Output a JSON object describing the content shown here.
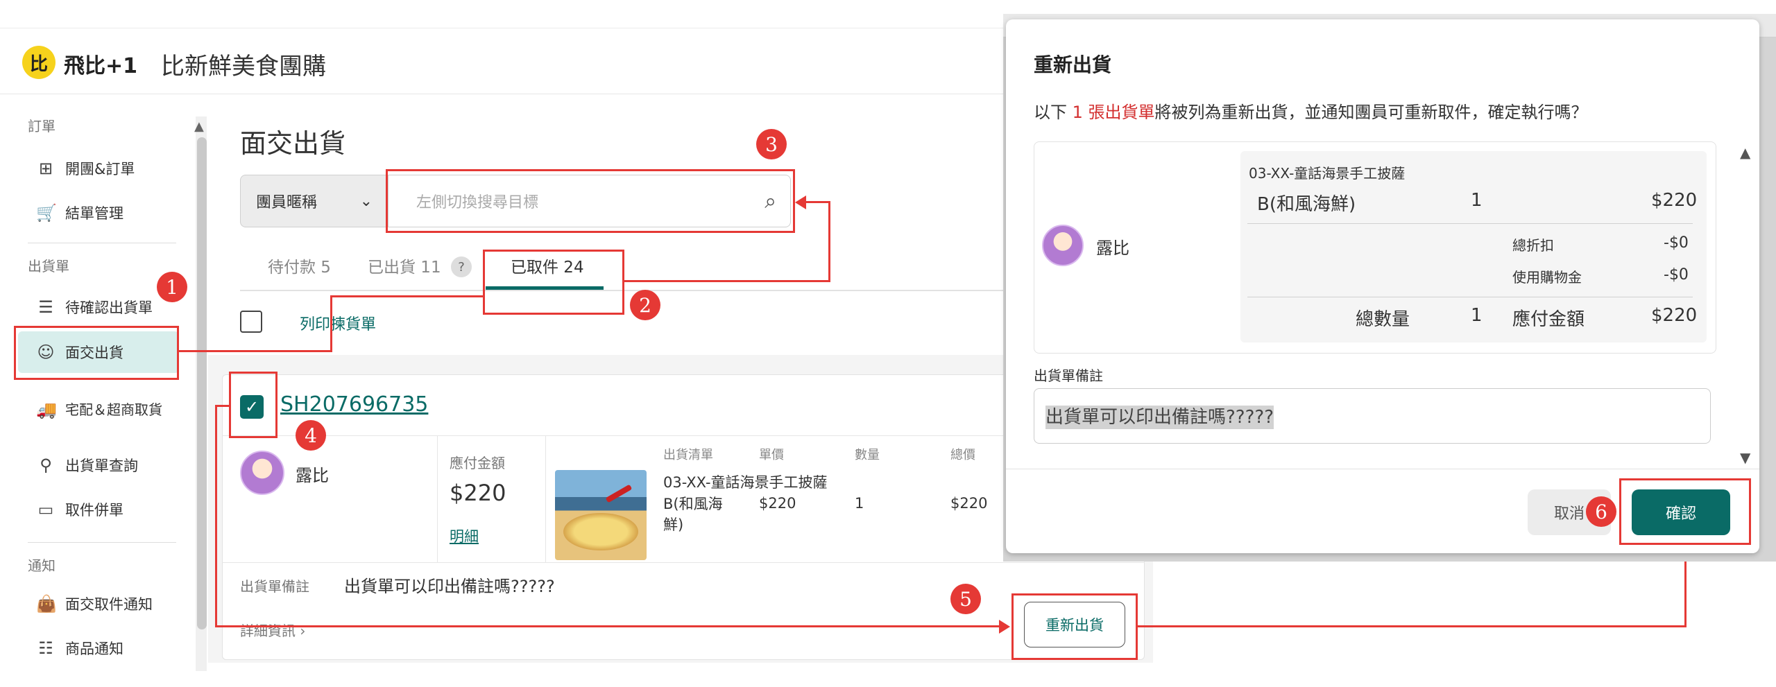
{
  "header": {
    "logo_mark": "比",
    "brand_name": "飛比+1",
    "shop_name": "比新鮮美食團購"
  },
  "sidebar": {
    "sections": [
      {
        "title": "訂單",
        "items": [
          {
            "icon": "grid-icon",
            "label": "開團&訂單"
          },
          {
            "icon": "cart-icon",
            "label": "結單管理"
          }
        ]
      },
      {
        "title": "出貨單",
        "items": [
          {
            "icon": "list-icon",
            "label": "待確認出貨單"
          },
          {
            "icon": "smile-icon",
            "label": "面交出貨"
          },
          {
            "icon": "truck-icon",
            "label": "宅配＆超商取貨"
          },
          {
            "icon": "search-icon",
            "label": "出貨單查詢"
          },
          {
            "icon": "box-icon",
            "label": "取件併單"
          }
        ]
      },
      {
        "title": "通知",
        "items": [
          {
            "icon": "bag-icon",
            "label": "面交取件通知"
          },
          {
            "icon": "sliders-icon",
            "label": "商品通知"
          }
        ]
      }
    ]
  },
  "main": {
    "title": "面交出貨",
    "filter_select": "團員暱稱",
    "search_placeholder": "左側切換搜尋目標",
    "tabs": [
      {
        "label": "待付款 5"
      },
      {
        "label": "已出貨 11"
      },
      {
        "label": "已取件 24"
      }
    ],
    "help_mark": "?",
    "print_label": "列印揀貨單",
    "order": {
      "id": "SH207696735",
      "user": "露比",
      "pay_label": "應付金額",
      "pay_amount": "$220",
      "detail_link": "明細",
      "table_headers": [
        "出貨清單",
        "單價",
        "數量",
        "總價"
      ],
      "item": {
        "name": "03-XX-童話海景手工披薩",
        "variant": "B(和風海鮮)",
        "price": "$220",
        "qty": "1",
        "total": "$220"
      },
      "remark_label": "出貨單備註",
      "remark": "出貨單可以印出備註嗎?????",
      "more_info": "詳細資訊 ›",
      "reship_button": "重新出貨"
    }
  },
  "annotations": {
    "markers": [
      "1",
      "2",
      "3",
      "4",
      "5",
      "6"
    ],
    "color": "#e53935"
  },
  "modal": {
    "title": "重新出貨",
    "desc_prefix": "以下 ",
    "desc_highlight": "1 張出貨單",
    "desc_suffix": "將被列為重新出貨，並通知團員可重新取件，確定執行嗎？",
    "user": "露比",
    "item_name": "03-XX-童話海景手工披薩",
    "item_variant": "B(和風海鮮)",
    "item_qty": "1",
    "item_amount": "$220",
    "discount_label": "總折扣",
    "discount_value": "-$0",
    "credit_label": "使用購物金",
    "credit_value": "-$0",
    "total_qty_label": "總數量",
    "total_qty_value": "1",
    "due_label": "應付金額",
    "due_value": "$220",
    "remark_label": "出貨單備註",
    "remark": "出貨單可以印出備註嗎?????",
    "cancel": "取消",
    "confirm": "確認"
  },
  "colors": {
    "accent": "#0a6b66",
    "highlight": "#d32f2f",
    "active_bg": "#d8eeec"
  }
}
